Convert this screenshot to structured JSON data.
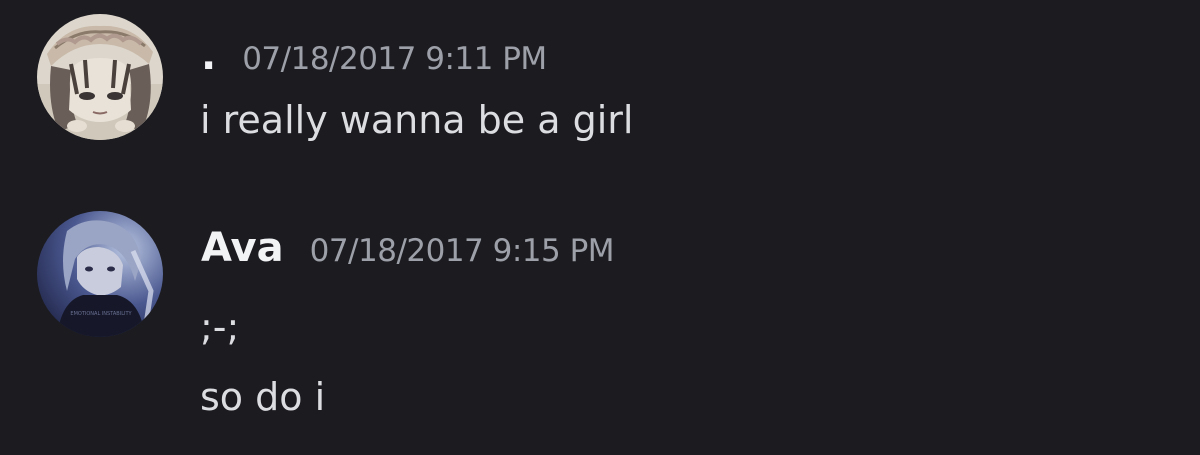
{
  "messages": [
    {
      "author": ".",
      "timestamp": "07/18/2017 9:11 PM",
      "avatar_icon": "anime-girl-avatar",
      "lines": [
        "i really wanna be a girl"
      ]
    },
    {
      "author": "Ava",
      "timestamp": "07/18/2017 9:15 PM",
      "avatar_icon": "anime-girl-dark-shirt-avatar",
      "avatar_shirt_text": "EMOTIONAL INSTABILITY",
      "lines": [
        ";-;",
        "so do i"
      ]
    }
  ],
  "colors": {
    "background": "#1b1b20",
    "username": "#f2f3f5",
    "timestamp": "#9da0a8",
    "message_text": "#dcdde1"
  }
}
